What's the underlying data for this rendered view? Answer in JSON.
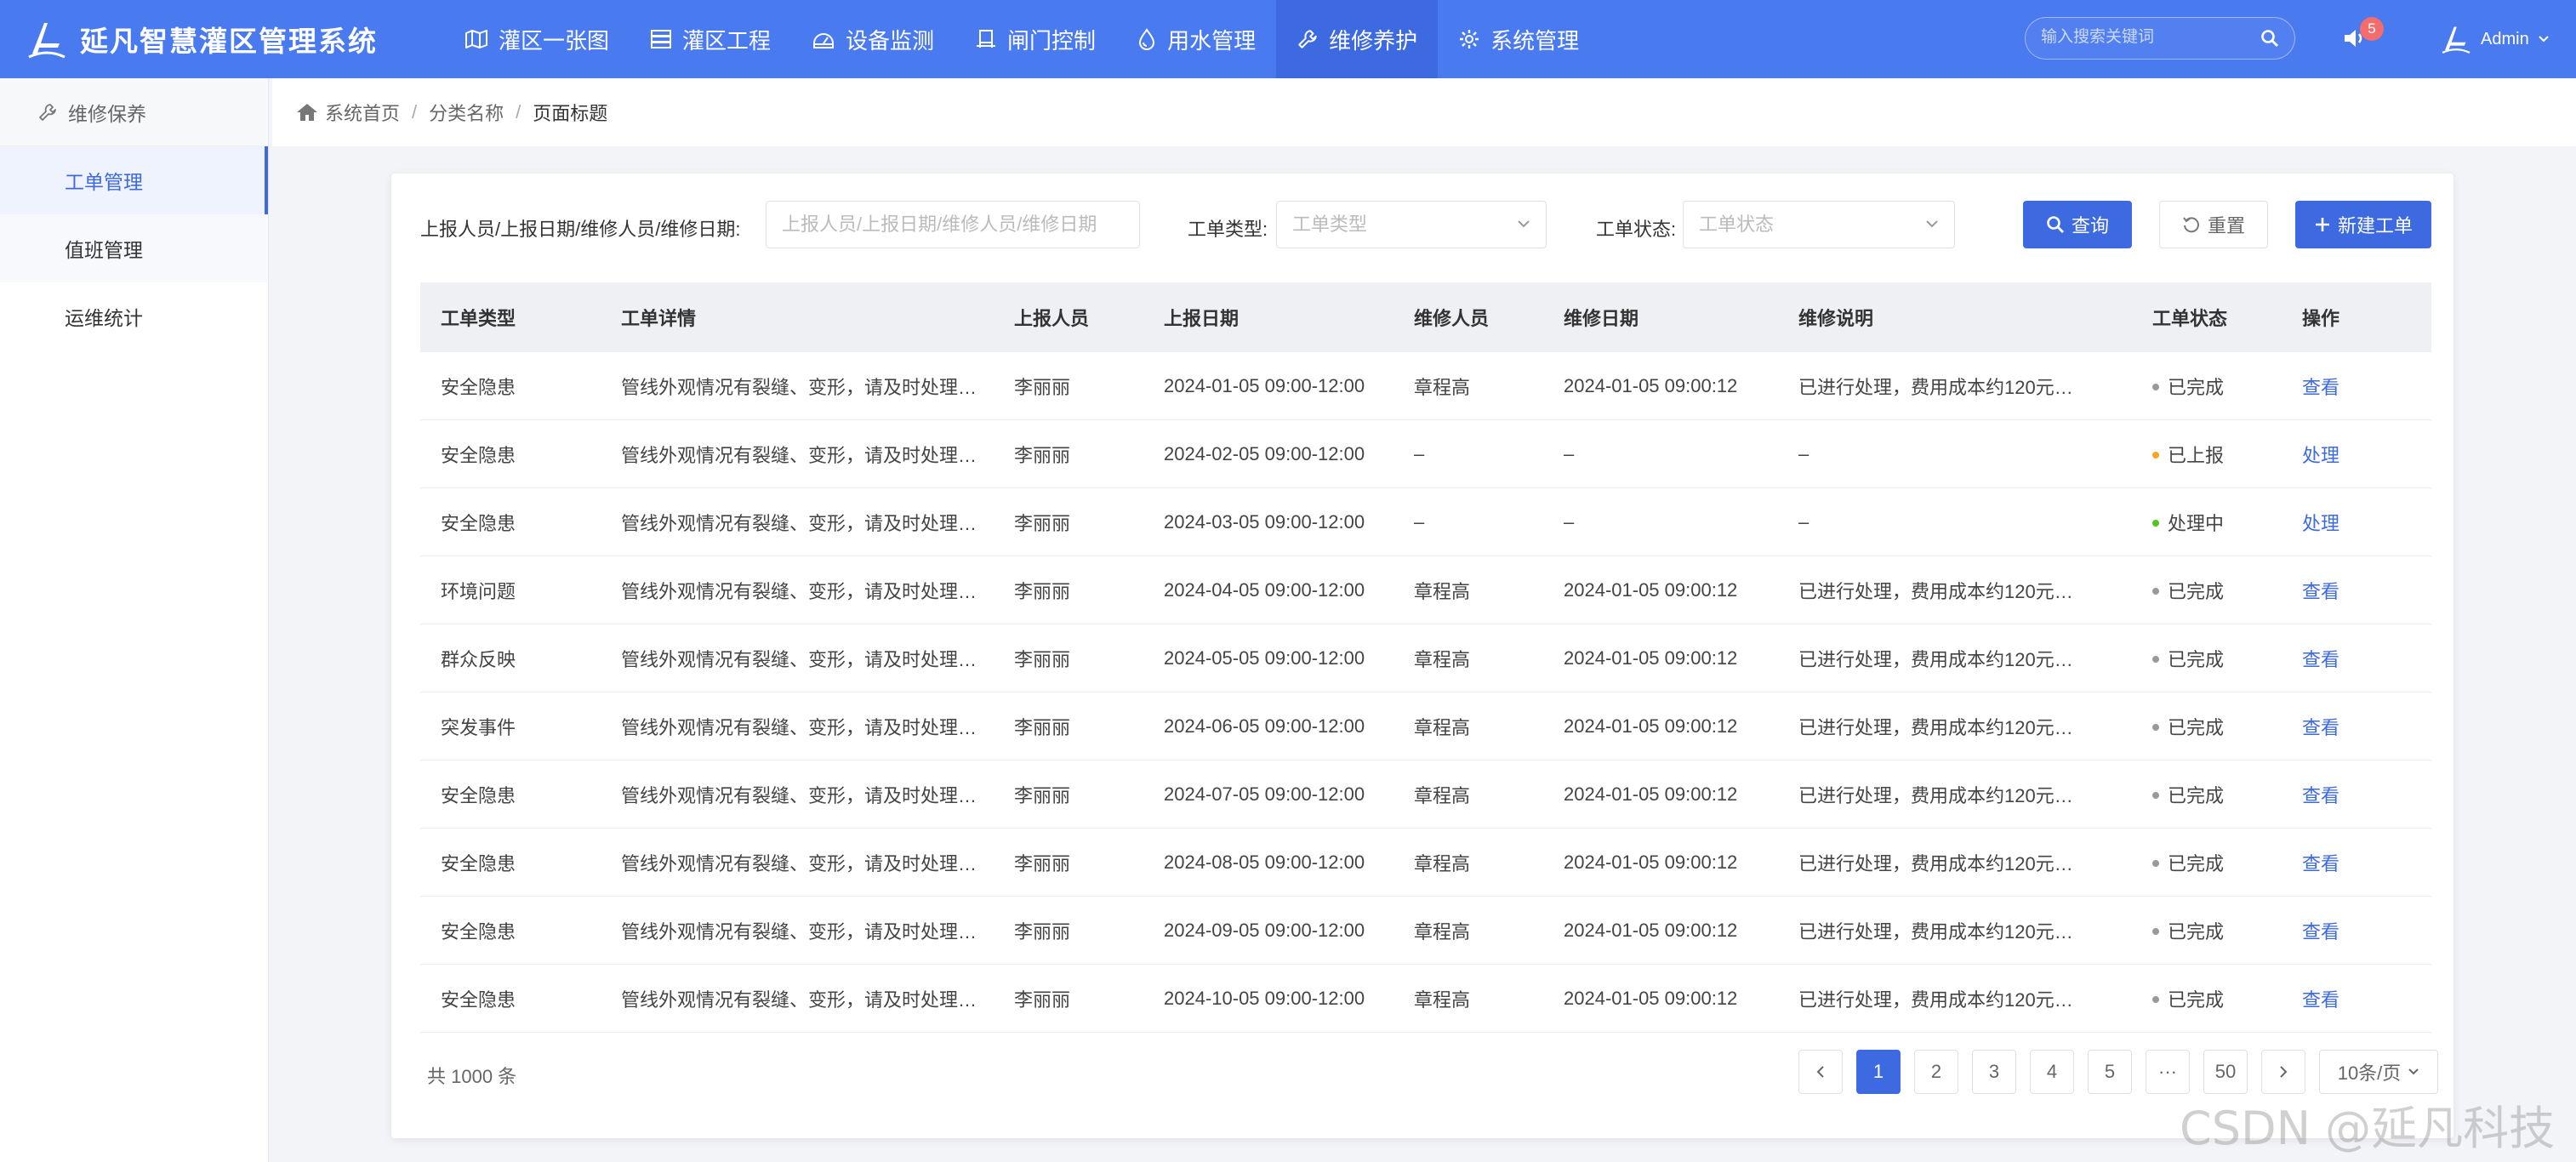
{
  "app": {
    "title": "延凡智慧灌区管理系统"
  },
  "nav": [
    {
      "label": "灌区一张图",
      "icon": "map-icon"
    },
    {
      "label": "灌区工程",
      "icon": "server-icon"
    },
    {
      "label": "设备监测",
      "icon": "monitor-icon"
    },
    {
      "label": "闸门控制",
      "icon": "gate-icon"
    },
    {
      "label": "用水管理",
      "icon": "water-drop-icon"
    },
    {
      "label": "维修养护",
      "icon": "wrench-icon",
      "active": true
    },
    {
      "label": "系统管理",
      "icon": "gear-icon"
    }
  ],
  "search": {
    "placeholder": "输入搜索关键词"
  },
  "notifications": {
    "count": "5"
  },
  "user": {
    "name": "Admin"
  },
  "sidebar": {
    "header": "维修保养",
    "items": [
      {
        "label": "工单管理",
        "active": true
      },
      {
        "label": "值班管理"
      },
      {
        "label": "运维统计"
      }
    ]
  },
  "breadcrumb": {
    "home": "系统首页",
    "sep": "/",
    "category": "分类名称",
    "current": "页面标题"
  },
  "filters": {
    "combined_label": "上报人员/上报日期/维修人员/维修日期:",
    "combined_placeholder": "上报人员/上报日期/维修人员/维修日期",
    "type_label": "工单类型:",
    "type_placeholder": "工单类型",
    "status_label": "工单状态:",
    "status_placeholder": "工单状态",
    "query_button": "查询",
    "reset_button": "重置",
    "new_button": "新建工单"
  },
  "table": {
    "columns": [
      "工单类型",
      "工单详情",
      "上报人员",
      "上报日期",
      "维修人员",
      "维修日期",
      "维修说明",
      "工单状态",
      "操作"
    ],
    "rows": [
      [
        "安全隐患",
        "管线外观情况有裂缝、变形，请及时处理…",
        "李丽丽",
        "2024-01-05 09:00-12:00",
        "章程高",
        "2024-01-05 09:00:12",
        "已进行处理，费用成本约120元…",
        "已完成",
        "查看"
      ],
      [
        "安全隐患",
        "管线外观情况有裂缝、变形，请及时处理…",
        "李丽丽",
        "2024-02-05 09:00-12:00",
        "–",
        "–",
        "–",
        "已上报",
        "处理"
      ],
      [
        "安全隐患",
        "管线外观情况有裂缝、变形，请及时处理…",
        "李丽丽",
        "2024-03-05 09:00-12:00",
        "–",
        "–",
        "–",
        "处理中",
        "处理"
      ],
      [
        "环境问题",
        "管线外观情况有裂缝、变形，请及时处理…",
        "李丽丽",
        "2024-04-05 09:00-12:00",
        "章程高",
        "2024-01-05 09:00:12",
        "已进行处理，费用成本约120元…",
        "已完成",
        "查看"
      ],
      [
        "群众反映",
        "管线外观情况有裂缝、变形，请及时处理…",
        "李丽丽",
        "2024-05-05 09:00-12:00",
        "章程高",
        "2024-01-05 09:00:12",
        "已进行处理，费用成本约120元…",
        "已完成",
        "查看"
      ],
      [
        "突发事件",
        "管线外观情况有裂缝、变形，请及时处理…",
        "李丽丽",
        "2024-06-05 09:00-12:00",
        "章程高",
        "2024-01-05 09:00:12",
        "已进行处理，费用成本约120元…",
        "已完成",
        "查看"
      ],
      [
        "安全隐患",
        "管线外观情况有裂缝、变形，请及时处理…",
        "李丽丽",
        "2024-07-05 09:00-12:00",
        "章程高",
        "2024-01-05 09:00:12",
        "已进行处理，费用成本约120元…",
        "已完成",
        "查看"
      ],
      [
        "安全隐患",
        "管线外观情况有裂缝、变形，请及时处理…",
        "李丽丽",
        "2024-08-05 09:00-12:00",
        "章程高",
        "2024-01-05 09:00:12",
        "已进行处理，费用成本约120元…",
        "已完成",
        "查看"
      ],
      [
        "安全隐患",
        "管线外观情况有裂缝、变形，请及时处理…",
        "李丽丽",
        "2024-09-05 09:00-12:00",
        "章程高",
        "2024-01-05 09:00:12",
        "已进行处理，费用成本约120元…",
        "已完成",
        "查看"
      ],
      [
        "安全隐患",
        "管线外观情况有裂缝、变形，请及时处理…",
        "李丽丽",
        "2024-10-05 09:00-12:00",
        "章程高",
        "2024-01-05 09:00:12",
        "已进行处理，费用成本约120元…",
        "已完成",
        "查看"
      ]
    ],
    "status_colors": {
      "已完成": "#999999",
      "已上报": "#f5a623",
      "处理中": "#52c41a"
    }
  },
  "pagination": {
    "total": "共 1000 条",
    "pages": [
      "1",
      "2",
      "3",
      "4",
      "5",
      "···",
      "50"
    ],
    "current": "1",
    "page_size": "10条/页"
  },
  "watermark": "CSDN @延凡科技",
  "colors": {
    "primary": "#3d6ae0",
    "topbar": "#4a7af0"
  }
}
